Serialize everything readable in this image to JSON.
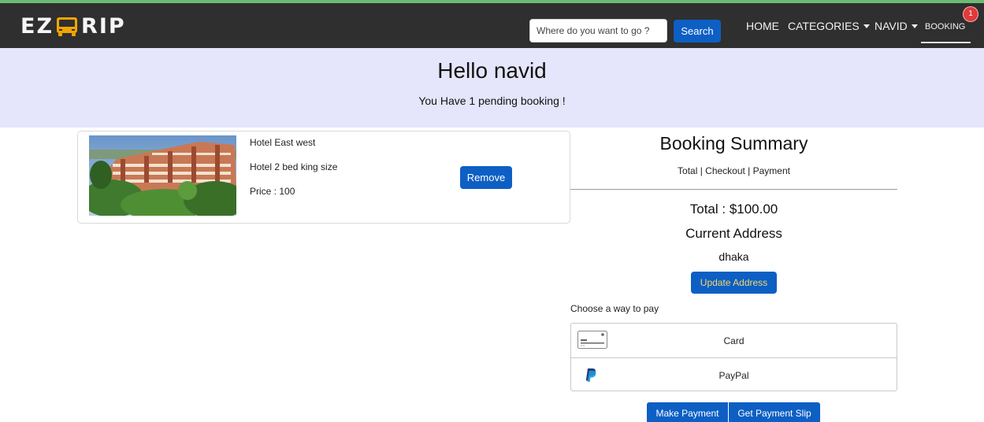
{
  "brand": {
    "logo_left": "EZ",
    "logo_right": "RIP"
  },
  "header": {
    "search_placeholder": "Where do you want to go ?",
    "search_button": "Search",
    "nav": {
      "home": "HOME",
      "categories": "CATEGORIES",
      "user": "NAVID",
      "booking": "BOOKING",
      "booking_badge": "1"
    }
  },
  "hero": {
    "title": "Hello navid",
    "subtitle": "You Have 1 pending booking !"
  },
  "cart": {
    "items": [
      {
        "name": "Hotel East west",
        "room": "Hotel 2 bed king size",
        "price": "Price : 100",
        "remove_label": "Remove"
      }
    ]
  },
  "summary": {
    "title": "Booking Summary",
    "steps": "Total | Checkout | Payment",
    "total": "Total : $100.00",
    "address_title": "Current Address",
    "address_value": "dhaka",
    "update_address_label": "Update Address",
    "choose_label": "Choose a way to pay",
    "payment_methods": [
      {
        "label": "Card",
        "icon": "credit-card-icon"
      },
      {
        "label": "PayPal",
        "icon": "paypal-icon"
      }
    ],
    "make_payment_label": "Make Payment",
    "payment_slip_label": "Get Payment Slip"
  },
  "colors": {
    "navbar": "#2f2f2f",
    "hero_bg": "#e5e5fb",
    "primary": "#0d5fc4",
    "badge": "#e03a3a",
    "logo_bus": "#f0a500"
  }
}
